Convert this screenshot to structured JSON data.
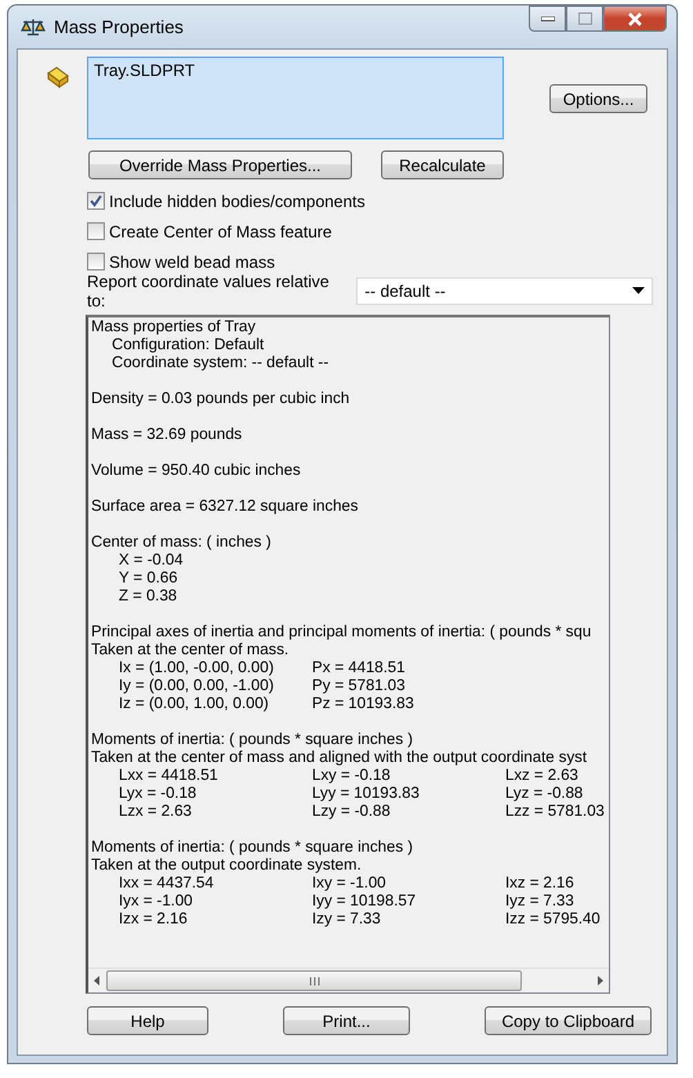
{
  "window": {
    "title": "Mass Properties"
  },
  "file_list": [
    "Tray.SLDPRT"
  ],
  "buttons_top": [
    {
      "label": "Override Mass Properties..."
    },
    {
      "label": "Recalculate"
    }
  ],
  "options_button": "Options...",
  "checkboxes": [
    {
      "label": "Include hidden bodies/components",
      "checked": true
    },
    {
      "label": "Create Center of Mass feature",
      "checked": false
    },
    {
      "label": "Show weld bead mass",
      "checked": false
    }
  ],
  "coordinate": {
    "label": "Report coordinate values relative to:",
    "value": "-- default --"
  },
  "report": [
    [
      {
        "kind": "plain",
        "text": "Mass properties of Tray"
      },
      {
        "kind": "detail",
        "text": "Configuration: Default"
      },
      {
        "kind": "detail",
        "text": "Coordinate system: -- default --"
      }
    ],
    [
      {
        "kind": "plain",
        "text": "Density = 0.03 pounds per cubic inch"
      }
    ],
    [
      {
        "kind": "plain",
        "text": "Mass = 32.69 pounds"
      }
    ],
    [
      {
        "kind": "plain",
        "text": "Volume = 950.40 cubic inches"
      }
    ],
    [
      {
        "kind": "plain",
        "text": "Surface area = 6327.12 square inches"
      }
    ],
    [
      {
        "kind": "plain",
        "text": "Center of mass: ( inches )"
      },
      {
        "kind": "value",
        "text": "X = -0.04"
      },
      {
        "kind": "value",
        "text": "Y = 0.66"
      },
      {
        "kind": "value",
        "text": "Z = 0.38"
      }
    ],
    [
      {
        "kind": "plain",
        "text": "Principal axes of inertia and principal moments of inertia: ( pounds * squ"
      },
      {
        "kind": "plain",
        "text": "Taken at the center of mass."
      },
      {
        "kind": "row",
        "cells": [
          "Ix = (1.00, -0.00, 0.00)",
          "Px = 4418.51"
        ]
      },
      {
        "kind": "row",
        "cells": [
          "Iy = (0.00, 0.00, -1.00)",
          "Py = 5781.03"
        ]
      },
      {
        "kind": "row",
        "cells": [
          "Iz = (0.00, 1.00, 0.00)",
          "Pz = 10193.83"
        ]
      }
    ],
    [
      {
        "kind": "plain",
        "text": "Moments of inertia: ( pounds * square inches )"
      },
      {
        "kind": "plain",
        "text": "Taken at the center of mass and aligned with the output coordinate syst"
      },
      {
        "kind": "row",
        "cells": [
          "Lxx = 4418.51",
          "Lxy = -0.18",
          "Lxz = 2.63"
        ]
      },
      {
        "kind": "row",
        "cells": [
          "Lyx = -0.18",
          "Lyy = 10193.83",
          "Lyz = -0.88"
        ]
      },
      {
        "kind": "row",
        "cells": [
          "Lzx = 2.63",
          "Lzy = -0.88",
          "Lzz = 5781.03"
        ]
      }
    ],
    [
      {
        "kind": "plain",
        "text": "Moments of inertia: ( pounds * square inches )"
      },
      {
        "kind": "plain",
        "text": "Taken at the output coordinate system."
      },
      {
        "kind": "row",
        "cells": [
          "Ixx = 4437.54",
          "Ixy = -1.00",
          "Ixz = 2.16"
        ]
      },
      {
        "kind": "row",
        "cells": [
          "Iyx = -1.00",
          "Iyy = 10198.57",
          "Iyz = 7.33"
        ]
      },
      {
        "kind": "row",
        "cells": [
          "Izx = 2.16",
          "Izy = 7.33",
          "Izz = 5795.40"
        ]
      }
    ]
  ],
  "buttons_bottom": [
    {
      "label": "Help"
    },
    {
      "label": "Print..."
    },
    {
      "label": "Copy to Clipboard"
    }
  ]
}
